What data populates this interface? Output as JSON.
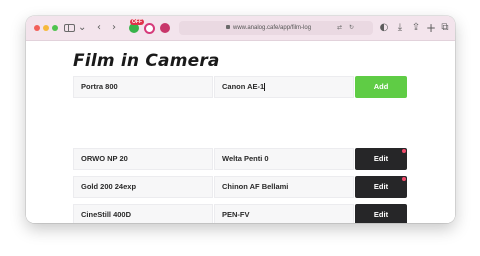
{
  "browser": {
    "url": "www.analog.cafe/app/film-log",
    "extension_badge": "OFF"
  },
  "page": {
    "title": "Film in Camera"
  },
  "new_entry": {
    "film_value": "Portra 800",
    "camera_value": "Canon AE-1",
    "add_label": "Add"
  },
  "log": {
    "edit_label": "Edit",
    "rows": [
      {
        "film": "ORWO NP 20",
        "camera": "Welta Penti 0",
        "marked": true
      },
      {
        "film": "Gold 200 24exp",
        "camera": "Chinon AF Bellami",
        "marked": true
      },
      {
        "film": "CineStill 400D",
        "camera": "PEN-FV",
        "marked": false
      },
      {
        "film": "",
        "camera": "",
        "marked": false
      }
    ]
  },
  "colors": {
    "accent_add": "#5fcc45",
    "edit_button": "#262628",
    "marker": "#f04a6a"
  }
}
